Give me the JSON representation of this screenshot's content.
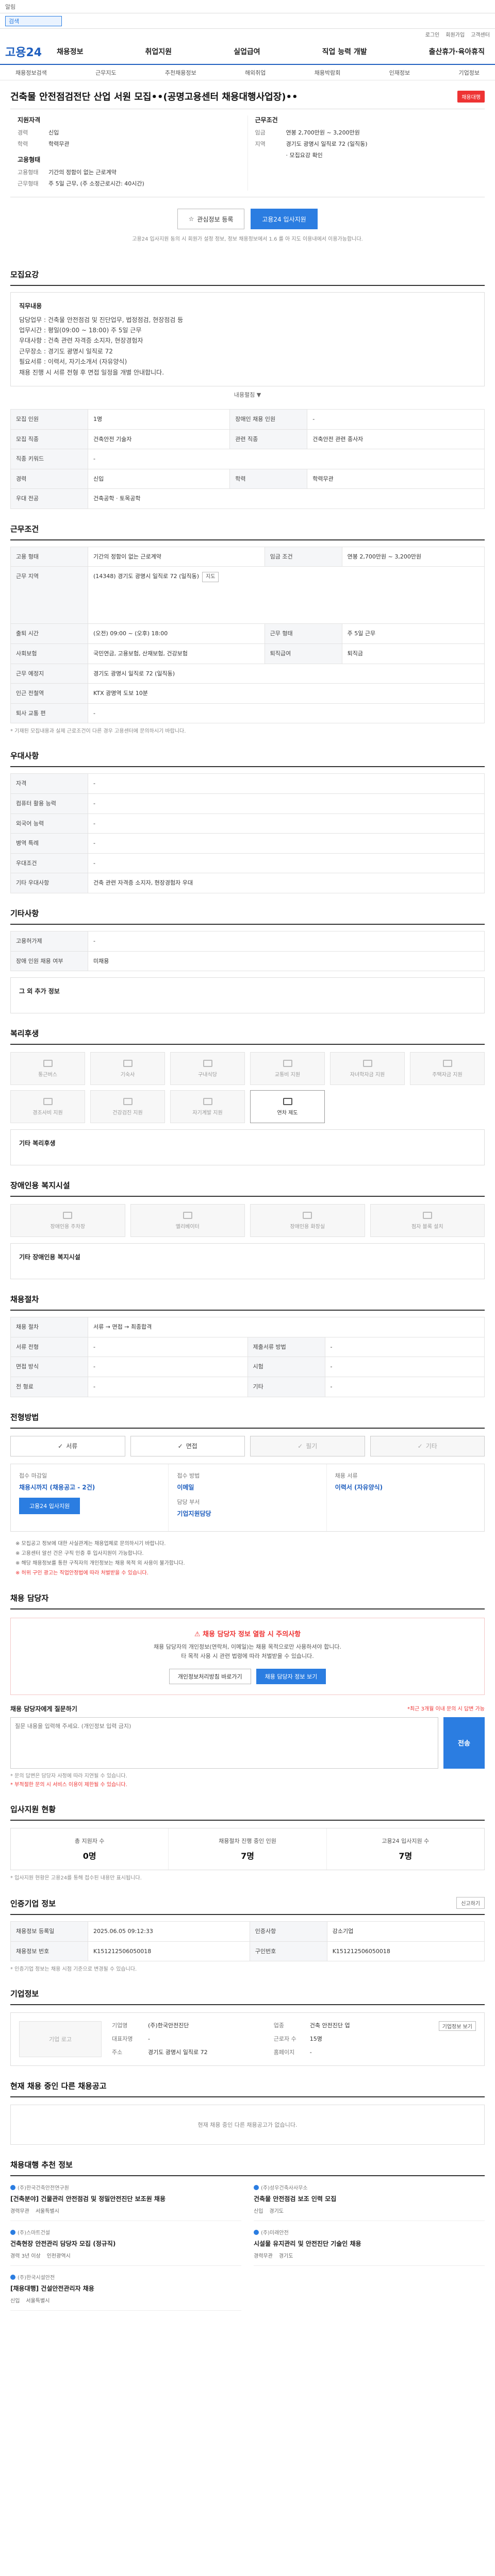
{
  "notice": "알림",
  "search": {
    "placeholder": "검색"
  },
  "util": [
    "로그인",
    "회원가입",
    "고객센터"
  ],
  "logo": "고용24",
  "gnb": [
    "채용정보",
    "취업지원",
    "실업급여",
    "직업 능력 개발",
    "출산휴가·육아휴직"
  ],
  "subtabs": [
    "채용정보검색",
    "근무지도",
    "추천채용정보",
    "해외취업",
    "채용박람회",
    "인재정보",
    "기업정보"
  ],
  "job": {
    "title": "건축물 안전점검전단 산업 서원 모집••(공명고용센터 채용대행사업장)••",
    "badge": "채용대행"
  },
  "summary": {
    "left_title": "지원자격",
    "left": [
      {
        "k": "경력",
        "v": "신입"
      },
      {
        "k": "학력",
        "v": "학력무관"
      }
    ],
    "mid_title": "고용형태",
    "mid": [
      {
        "k": "고용형태",
        "v": "기간의 정함이 없는 근로계약"
      },
      {
        "k": "근무형태",
        "v": "주 5일 근무, (주 소정근로시간: 40시간)"
      }
    ],
    "right_title": "근무조건",
    "right": [
      {
        "k": "임금",
        "v": "연봉 2,700만원 ~ 3,200만원"
      },
      {
        "k": "지역",
        "v": "경기도 광명시 일직로 72 (일직동)"
      },
      {
        "k": "",
        "v": "· 모집요강 확인"
      }
    ]
  },
  "buttons": {
    "scrap": "관심정보 등록",
    "apply": "고용24 입사지원"
  },
  "caption": "고용24 입사지원 동의 시 회원가 설정 정보, 정보 채용정보에서 1.6 를 아 지도 이용내에서 이용가능합니다.",
  "sections": {
    "detail": "모집요강",
    "work": "근무조건",
    "qual": "우대사항",
    "etc": "기타사항",
    "welfare": "복리후생",
    "access": "장애인용 복지시설",
    "selection": "채용절차",
    "method": "전형방법",
    "contact_title": "채용 담당자",
    "stats": "입사지원 현황",
    "company": "인증기업 정보",
    "company2": "기업정보",
    "others": "현재 채용 중인 다른 채용공고",
    "related": "채용대행 추천 정보"
  },
  "detail_box": {
    "h": "직무내용",
    "lines": [
      "담당업무 : 건축물 안전점검 및 진단업무, 법정점검, 현장점검 등",
      "업무시간 : 평일(09:00 ~ 18:00) 주 5일 근무",
      "우대사항 : 건축 관련 자격증 소지자, 현장경험자",
      "근무장소 : 경기도 광명시 일직로 72",
      "필요서류 : 이력서, 자기소개서 (자유양식)",
      "채용 진행 시 서류 전형 후 면접 일정을 개별 안내합니다."
    ],
    "toggle": "내용펼침 ▼"
  },
  "detail_table": [
    {
      "k": "모집 인원",
      "v": "1명",
      "k2": "장애인 채용 인원",
      "v2": "-"
    },
    {
      "k": "모집 직종",
      "v": "건축안전 기술자",
      "k2": "관련 직종",
      "v2": "건축안전 관련 종사자"
    },
    {
      "k": "직종 키워드",
      "v": "-",
      "k2": "",
      "v2": ""
    },
    {
      "k": "경력",
      "v": "신입",
      "k2": "학력",
      "v2": "학력무관"
    },
    {
      "k": "우대 전공",
      "v": "건축공학 · 토목공학",
      "k2": "",
      "v2": ""
    }
  ],
  "work_table": [
    {
      "k": "고용 형태",
      "v": "기간의 정함이 없는 근로계약",
      "k2": "임금 조건",
      "v2": "연봉 2,700만원 ~ 3,200만원"
    },
    {
      "k": "근무 지역",
      "v": "(14348) 경기도 광명시 일직로 72 (일직동)",
      "k2": "",
      "v2": ""
    },
    {
      "k": "출퇴 시간",
      "v": "(오전) 09:00 ~ (오후) 18:00",
      "k2": "근무 형태",
      "v2": "주 5일 근무"
    },
    {
      "k": "사회보험",
      "v": "국민연금, 고용보험, 산재보험, 건강보험",
      "k2": "퇴직급여",
      "v2": "퇴직금"
    },
    {
      "k": "근무 예정지",
      "v": "경기도 광명시 일직로 72 (일직동)",
      "k2": "",
      "v2": ""
    },
    {
      "k": "인근 전철역",
      "v": "KTX 광명역 도보 10분",
      "k2": "",
      "v2": ""
    },
    {
      "k": "퇴사 교통 편",
      "v": "-",
      "k2": "",
      "v2": ""
    }
  ],
  "work_note": "* 기재된 모집내용과 실제 근로조건이 다른 경우 고용센터에 문의하시기 바랍니다.",
  "qual_table": [
    {
      "k": "자격",
      "v": "-"
    },
    {
      "k": "컴퓨터 활용 능력",
      "v": "-"
    },
    {
      "k": "외국어 능력",
      "v": "-"
    },
    {
      "k": "병역 특례",
      "v": "-"
    },
    {
      "k": "우대조건",
      "v": "-"
    },
    {
      "k": "기타 우대사항",
      "v": "건축 관련 자격증 소지자, 현장경험자 우대"
    }
  ],
  "etc_table": [
    {
      "k": "고용허가제",
      "v": "-"
    },
    {
      "k": "장애 인원 채용 여부",
      "v": "미채용"
    }
  ],
  "etc_more": "그 외 추가 정보",
  "welfare_items": [
    {
      "label": "통근버스",
      "on": false
    },
    {
      "label": "기숙사",
      "on": false
    },
    {
      "label": "구내식당",
      "on": false
    },
    {
      "label": "교통비 지원",
      "on": false
    },
    {
      "label": "자녀학자금 지원",
      "on": false
    },
    {
      "label": "주택자금 지원",
      "on": false
    },
    {
      "label": "경조사비 지원",
      "on": false
    },
    {
      "label": "건강검진 지원",
      "on": false
    },
    {
      "label": "자기계발 지원",
      "on": false
    },
    {
      "label": "연차 제도",
      "on": true
    }
  ],
  "welfare_more": "기타 복리후생",
  "access_items": [
    "장애인용 주차장",
    "엘리베이터",
    "장애인용 화장실",
    "점자 블록 설치"
  ],
  "access_more": "기타 장애인용 복지시설",
  "selection_table": [
    {
      "k": "채용 절차",
      "v": "서류 → 면접 → 최종합격",
      "k2": "",
      "v2": ""
    },
    {
      "k": "서류 전형",
      "v": "-",
      "k2": "제출서류 방법",
      "v2": "-"
    },
    {
      "k": "면접 방식",
      "v": "-",
      "k2": "시험",
      "v2": "-"
    },
    {
      "k": "전 형료",
      "v": "-",
      "k2": "기타",
      "v2": "-"
    }
  ],
  "methods": [
    {
      "label": "서류",
      "on": true
    },
    {
      "label": "면접",
      "on": true
    },
    {
      "label": "필기",
      "on": false
    },
    {
      "label": "기타",
      "on": false
    }
  ],
  "contact": {
    "a_h": "접수 마감일",
    "a_v": "채용시까지 (채용공고 - 2건)",
    "a_btn": "고용24 입사지원",
    "b_h": "접수 방법",
    "b_v": "이메일",
    "c_h": "담당 부서",
    "c_v": "기업지원담당",
    "d_h": "채용 서류",
    "d_v": "이력서 (자유양식)"
  },
  "bullets": [
    "※ 모집공고 정보에 대한 사실관계는 채용업체로 문의하시기 바랍니다.",
    "※ 고용센터 알선 건은 구직 인증 후 입사지원이 가능합니다.",
    "※ 해당 채용정보를 통한 구직자의 개인정보는 채용 목적 외 사용이 불가합니다.",
    "※ 허위 구인 광고는 직업안정법에 따라 처벌받을 수 있습니다."
  ],
  "safety": {
    "title": "채용 담당자 정보 열람 시 주의사항",
    "lines": [
      "채용 담당자의 개인정보(연락처, 이메일)는 채용 목적으로만 사용하셔야 합니다.",
      "타 목적 사용 시 관련 법령에 따라 처벌받을 수 있습니다."
    ],
    "btn1": "채용 담당자 정보 보기",
    "btn2": "개인정보처리방침 바로가기"
  },
  "qna": {
    "title": "채용 담당자에게 질문하기",
    "right": "*최근 3개월 이내 문의 시 답변 가능",
    "placeholder": "질문 내용을 입력해 주세요. (개인정보 입력 금지)",
    "send": "전송",
    "notes": [
      "* 문의 답변은 담당자 사정에 따라 지연될 수 있습니다.",
      "* 부적절한 문의 시 서비스 이용이 제한될 수 있습니다."
    ]
  },
  "stats": [
    {
      "h": "총 지원자 수",
      "v": "0명"
    },
    {
      "h": "채용절차 진행 중인 인원",
      "v": "7명"
    },
    {
      "h": "고용24 입사지원 수",
      "v": "7명"
    }
  ],
  "stats_note": "* 입사지원 현황은 고용24를 통해 접수된 내용만 표시됩니다.",
  "cert_table": [
    {
      "k": "채용정보 등록일",
      "v": "2025.06.05 09:12:33",
      "k2": "인증사항",
      "v2": "강소기업"
    },
    {
      "k": "채용정보 번호",
      "v": "K151212506050018",
      "k2": "구인번호",
      "v2": "K151212506050018"
    }
  ],
  "cert_btn": "신고하기",
  "cert_note": "* 인증기업 정보는 채용 시점 기준으로 변경될 수 있습니다.",
  "company": {
    "logo_alt": "기업 로고",
    "rows": [
      {
        "k": "기업명",
        "v": "(주)한국안전진단"
      },
      {
        "k": "업종",
        "v": "건축 안전진단 업"
      },
      {
        "k": "대표자명",
        "v": "-"
      },
      {
        "k": "근로자 수",
        "v": "15명"
      },
      {
        "k": "주소",
        "v": "경기도 광명시 일직로 72"
      },
      {
        "k": "홈페이지",
        "v": "-"
      }
    ],
    "btn": "기업정보 보기"
  },
  "others_empty": "현재 채용 중인 다른 채용공고가 없습니다.",
  "related": [
    {
      "cp": "(주)한국건축안전연구원",
      "t": "[건축분야] 건물관리 안전점검 및 정밀안전진단 보조원 채용",
      "a": "경력무관",
      "b": "서울특별시"
    },
    {
      "cp": "(주)성우건축사사무소",
      "t": "건축물 안전점검 보조 인력 모집",
      "a": "신입",
      "b": "경기도"
    },
    {
      "cp": "(주)스마트건설",
      "t": "건축현장 안전관리 담당자 모집 (정규직)",
      "a": "경력 3년 이상",
      "b": "인천광역시"
    },
    {
      "cp": "(주)미래안전",
      "t": "시설물 유지관리 및 안전진단 기술인 채용",
      "a": "경력무관",
      "b": "경기도"
    },
    {
      "cp": "(주)한국시설안전",
      "t": "[채용대행] 건설안전관리자 채용",
      "a": "신입",
      "b": "서울특별시"
    }
  ]
}
